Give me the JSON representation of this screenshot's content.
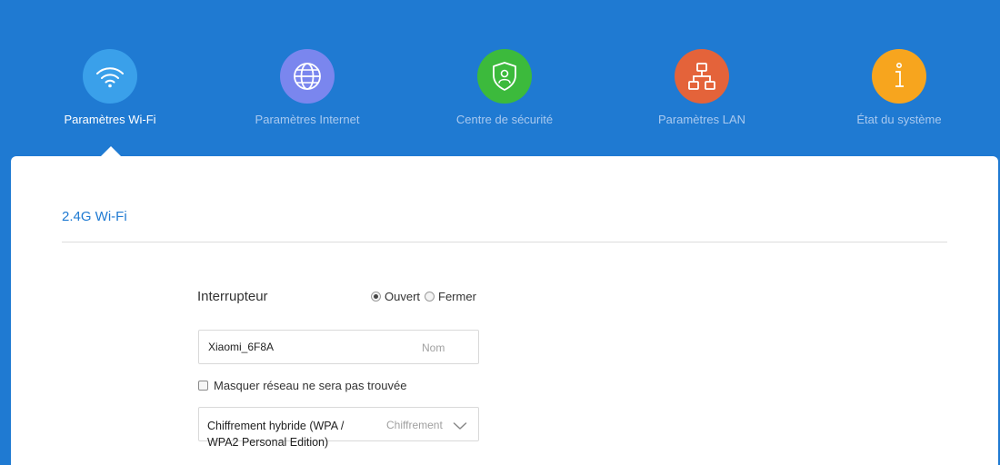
{
  "nav": {
    "items": [
      {
        "label": "Paramètres Wi-Fi",
        "icon": "wifi-icon",
        "color": "#3aa0ea",
        "active": true
      },
      {
        "label": "Paramètres Internet",
        "icon": "globe-icon",
        "color": "#7a86ee",
        "active": false
      },
      {
        "label": "Centre de sécurité",
        "icon": "shield-icon",
        "color": "#3cba3c",
        "active": false
      },
      {
        "label": "Paramètres LAN",
        "icon": "network-icon",
        "color": "#e4633a",
        "active": false
      },
      {
        "label": "État du système",
        "icon": "info-icon",
        "color": "#f7a51e",
        "active": false
      }
    ]
  },
  "colors": {
    "brand": "#1f7ad2",
    "panel": "#ffffff"
  },
  "section": {
    "title": "2.4G Wi-Fi"
  },
  "switch": {
    "label": "Interrupteur",
    "options": [
      {
        "label": "Ouvert",
        "checked": true
      },
      {
        "label": "Fermer",
        "checked": false
      }
    ]
  },
  "ssid": {
    "value": "Xiaomi_6F8A",
    "hint": "Nom"
  },
  "hide_network": {
    "label": "Masquer réseau ne sera pas trouvée",
    "checked": false
  },
  "encryption": {
    "line1": "Chiffrement hybride (WPA /",
    "line2": "WPA2 Personal Edition)",
    "hint": "Chiffrement",
    "icon": "chevron-down-icon"
  }
}
